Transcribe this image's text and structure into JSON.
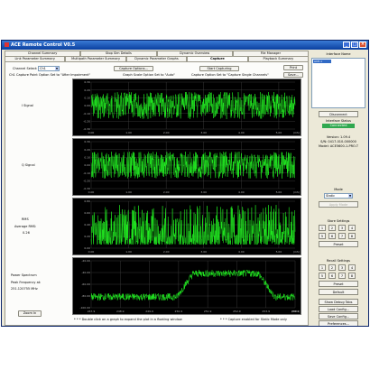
{
  "window": {
    "title": "ACE Remote Control V0.5"
  },
  "tabs_row1": [
    "Channel Summary",
    "Stop Sim Details",
    "Dynamic Overview",
    "File Manager"
  ],
  "tabs_row2": [
    "Link Parameter Summary",
    "Multipath Parameter Summary",
    "Dynamic Parameter Graphs",
    "Capture",
    "Playback Summary"
  ],
  "active_tab": "Capture",
  "capture": {
    "channel_select_label": "Channel Select:",
    "channel_value": "Ch1",
    "options_note": "Ch1 Capture Point Option Set to \"After Impairment\"",
    "capture_options_btn": "Capture Options...",
    "graph_scale_note": "Graph Scale Option Set to \"Auto\"",
    "start_capturing_btn": "Start Capturing",
    "capture_option_note": "Capture Option Set to \"Capture Single Channels\"",
    "print_btn": "Print",
    "save_btn": "Save...",
    "zoom_btn": "Zoom In",
    "footnote_left": "* * * Double click on a graph to expand the plot in a floating window",
    "footnote_right": "* * * Capture enabled for Static Mode only"
  },
  "graphs": [
    {
      "label": "I Signal",
      "y_ticks": [
        "0.30",
        "0.20",
        "0.10",
        "0.00",
        "-0.10",
        "-0.20",
        "-0.30"
      ],
      "x_ticks": [
        "0.00",
        "1.00",
        "2.00",
        "3.00",
        "4.00",
        "5.00"
      ],
      "x_unit": "(mS)"
    },
    {
      "label": "Q Signal",
      "y_ticks": [
        "0.30",
        "0.20",
        "0.10",
        "0.00",
        "-0.10",
        "-0.20",
        "-0.30"
      ],
      "x_ticks": [
        "0.00",
        "1.00",
        "2.00",
        "3.00",
        "4.00",
        "5.00"
      ],
      "x_unit": "(mS)"
    },
    {
      "label": "RMS",
      "sub_label": "Average RMS:",
      "sub_value": "0.26",
      "y_ticks": [
        "0.80",
        "0.60",
        "0.40",
        "0.20",
        "0.00"
      ],
      "x_ticks": [
        "0.00",
        "1.00",
        "2.00",
        "3.00",
        "4.00",
        "5.00"
      ],
      "x_unit": "(mS)"
    },
    {
      "label": "Power Spectrum",
      "sub_label": "Peak Frequency at:",
      "sub_value": "251.120755 MHz",
      "y_ticks": [
        "-20.00",
        "-40.00",
        "-60.00",
        "-80.00",
        "-100.00"
      ],
      "x_ticks": [
        "247.9",
        "248.9",
        "249.9",
        "250.9",
        "251.9",
        "252.9",
        "253.9",
        "254.9"
      ],
      "x_unit": "(MHz)"
    }
  ],
  "sidebar": {
    "interface_name_label": "Interface Name",
    "interface_item": "ACE-1",
    "disconnect_btn": "Disconnect",
    "status_label": "Interface Status",
    "status_value": "Connected",
    "version": "Version: 1.09.4",
    "serial": "S/N: 0417-010-000000",
    "model": "Model: ACE5600-1-PRO-T",
    "mode_label": "Mode",
    "mode_value": "Static",
    "mode_apply_btn": "Apply Mode",
    "store_label": "Store Settings",
    "store_nums": [
      "1",
      "2",
      "3",
      "4",
      "5",
      "6",
      "7",
      "8"
    ],
    "preset_btn": "Preset",
    "recall_label": "Recall Settings",
    "recall_nums": [
      "1",
      "2",
      "3",
      "4",
      "5",
      "6",
      "7",
      "8"
    ],
    "recall_preset_btn": "Preset",
    "default_btn": "Default",
    "debug_btn": "Show Debug Tabs",
    "load_btn": "Load Config...",
    "saveconf_btn": "Save Config...",
    "prefs_btn": "Preferences...",
    "exit_btn": "Exit"
  },
  "colors": {
    "trace": "#22ee22",
    "plot_bg": "#000000",
    "grid": "#444444",
    "status_ok": "#2fa84f"
  }
}
